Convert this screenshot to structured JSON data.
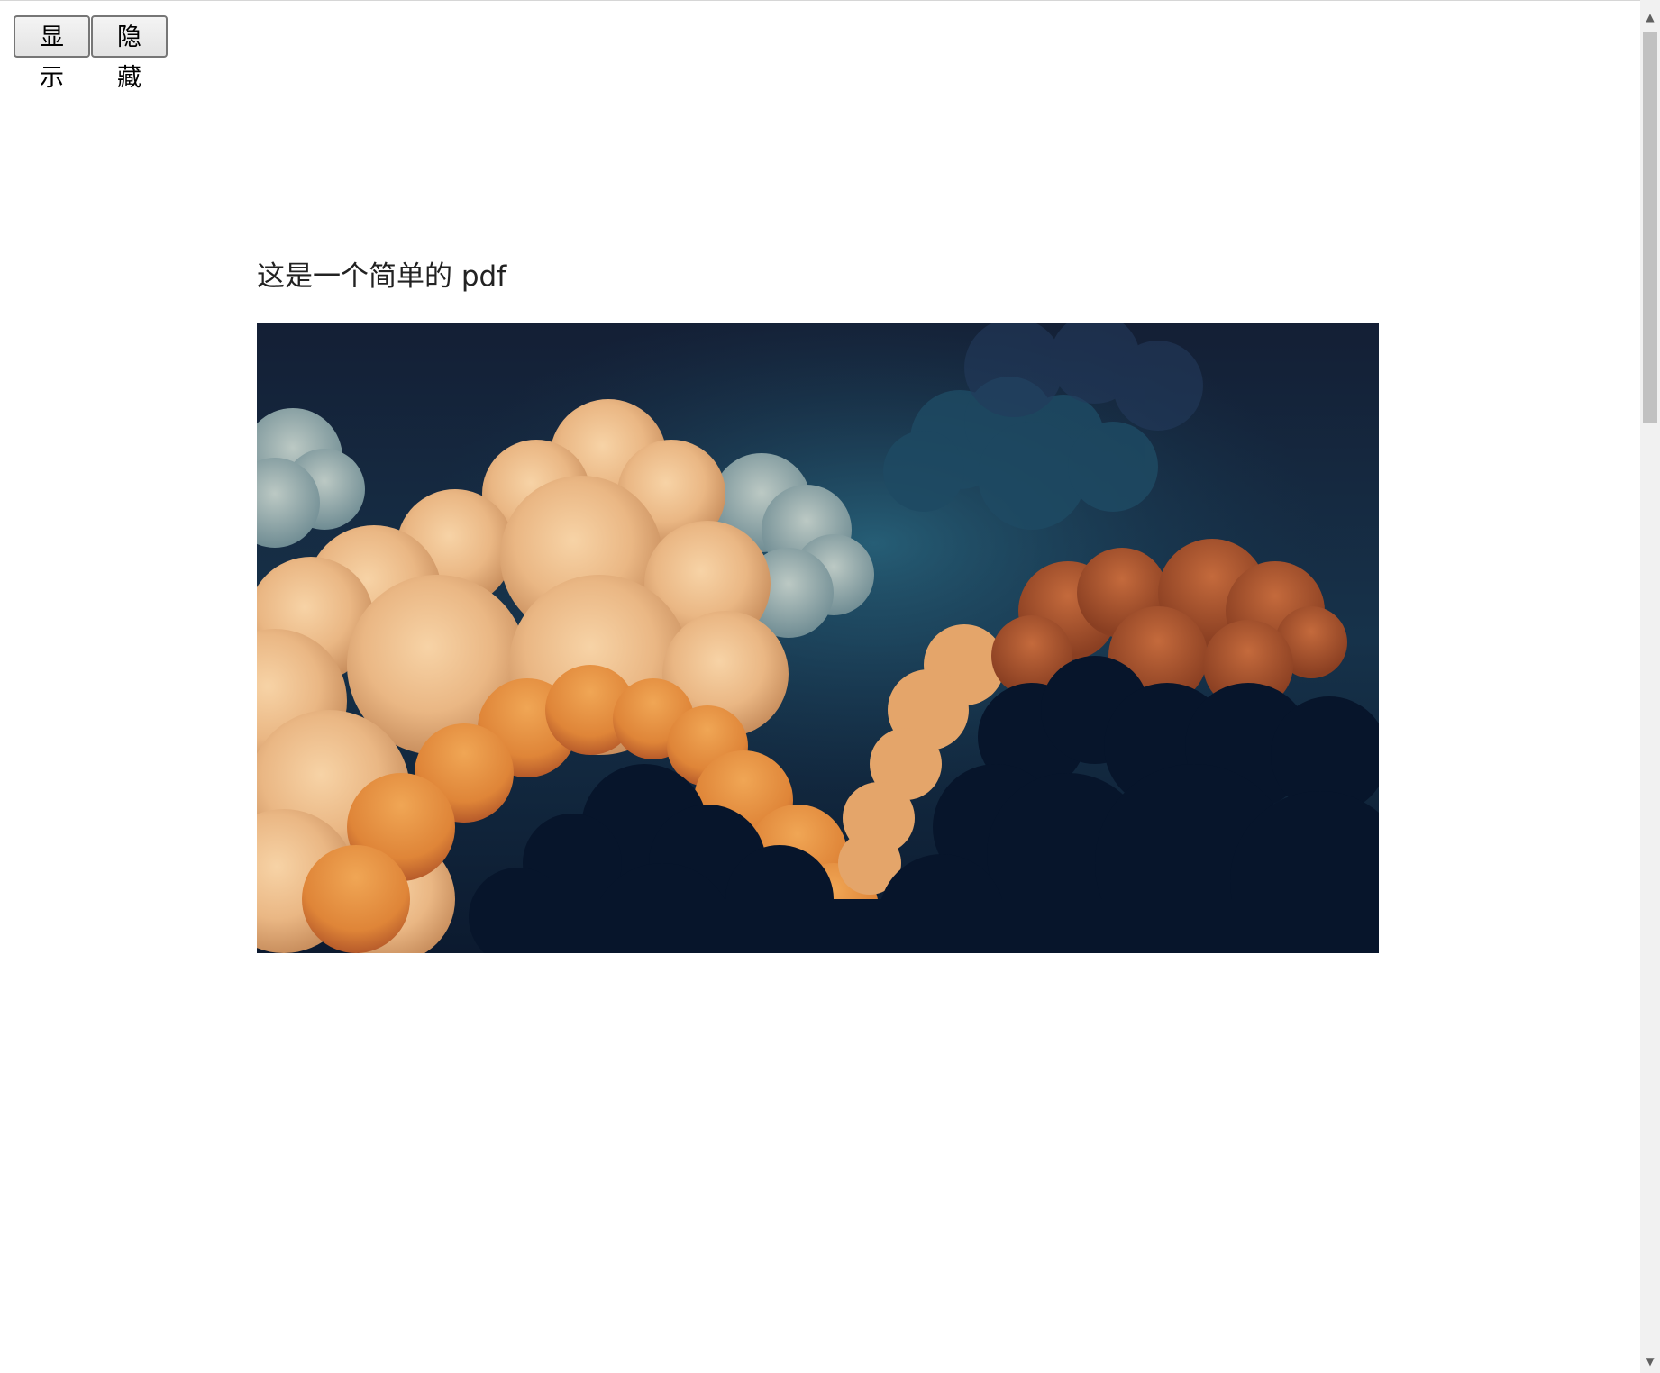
{
  "toolbar": {
    "show_label": "显示",
    "hide_label": "隐藏"
  },
  "document": {
    "title": "这是一个简单的 pdf"
  },
  "scrollbar": {
    "up_icon": "▲",
    "down_icon": "▼"
  },
  "colors": {
    "sky_dark": "#0e1d33",
    "sky_teal": "#1f4d66",
    "cloud_light": "#f1c89a",
    "cloud_orange": "#e08a3c",
    "cloud_rust": "#a9512e",
    "cloud_shadow": "#07152b",
    "cloud_pale_blue": "#9fb6b8"
  }
}
